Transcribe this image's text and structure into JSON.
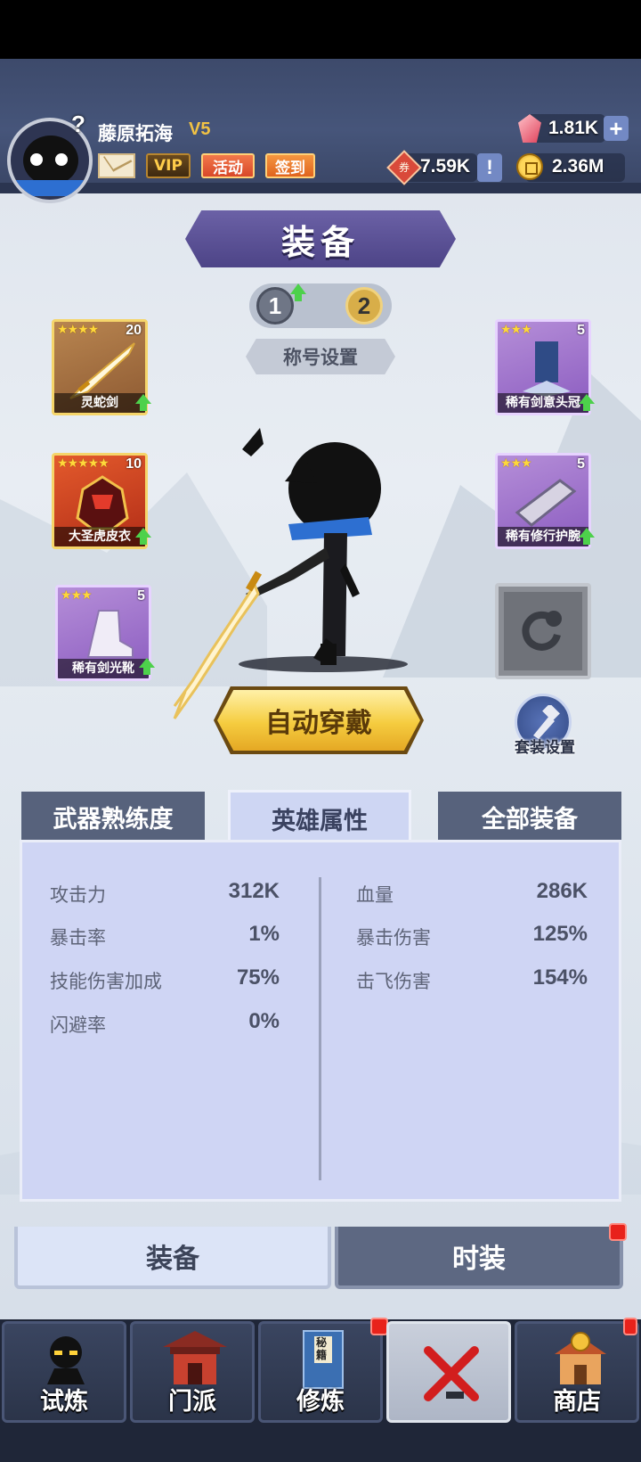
{
  "header": {
    "player_name": "藤原拓海",
    "vip_level": "V5",
    "buttons": [
      "VIP",
      "活动",
      "签到"
    ],
    "gems": "1.81K",
    "coupons": "7.59K",
    "coupon_icon_text": "券",
    "gold": "2.36M",
    "help_mark": "?"
  },
  "title": "装备",
  "pages": [
    "1",
    "2"
  ],
  "title_setting": "称号设置",
  "slots": {
    "weapon": {
      "name": "灵蛇剑",
      "level": "20",
      "stars": "★★★★"
    },
    "armor": {
      "name": "大圣虎皮衣",
      "level": "10",
      "stars": "★★★★★"
    },
    "boots": {
      "name": "稀有剑光靴",
      "level": "5",
      "stars": "★★★"
    },
    "helmet": {
      "name": "稀有剑意头冠",
      "level": "5",
      "stars": "★★★"
    },
    "bracer": {
      "name": "稀有修行护腕",
      "level": "5",
      "stars": "★★★"
    }
  },
  "auto_equip": "自动穿戴",
  "set_config": "套装设置",
  "tabs": [
    "武器熟练度",
    "英雄属性",
    "全部装备"
  ],
  "stats_left": [
    {
      "k": "攻击力",
      "v": "312K"
    },
    {
      "k": "暴击率",
      "v": "1%"
    },
    {
      "k": "技能伤害加成",
      "v": "75%"
    },
    {
      "k": "闪避率",
      "v": "0%"
    }
  ],
  "stats_right": [
    {
      "k": "血量",
      "v": "286K"
    },
    {
      "k": "暴击伤害",
      "v": "125%"
    },
    {
      "k": "击飞伤害",
      "v": "154%"
    }
  ],
  "subtabs": [
    "装备",
    "时装"
  ],
  "nav": [
    "试炼",
    "门派",
    "修炼",
    "",
    "商店"
  ],
  "scroll_text": "秘籍",
  "colors": {
    "accent_purple": "#5a5196",
    "gold": "#f5cc3f",
    "stat_panel": "#cfd5f4"
  }
}
